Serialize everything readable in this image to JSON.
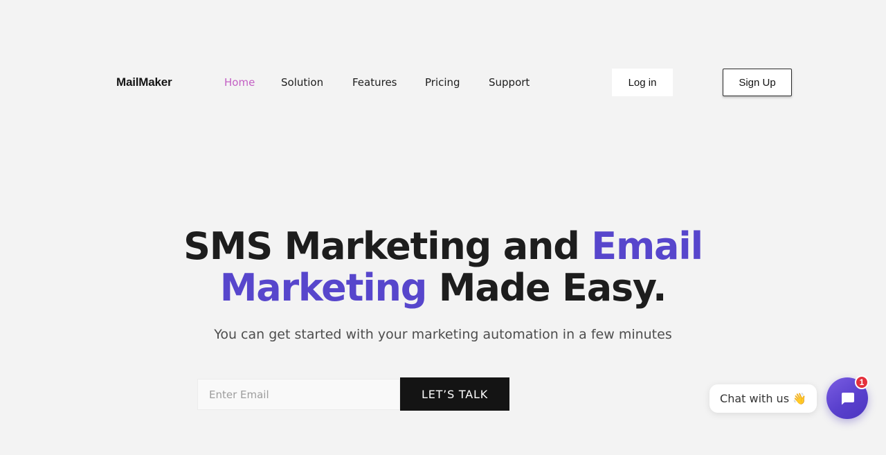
{
  "brand": {
    "name": "MailMaker"
  },
  "nav": {
    "items": [
      {
        "label": "Home",
        "active": true
      },
      {
        "label": "Solution",
        "active": false
      },
      {
        "label": "Features",
        "active": false
      },
      {
        "label": "Pricing",
        "active": false
      },
      {
        "label": "Support",
        "active": false
      }
    ]
  },
  "auth": {
    "login_label": "Log in",
    "signup_label": "Sign Up"
  },
  "hero": {
    "title_part1": "SMS Marketing and ",
    "title_accent1": "Email",
    "title_accent2": "Marketing",
    "title_part2": " Made Easy.",
    "subtitle": "You can get started with your marketing automation in a few minutes"
  },
  "signup_form": {
    "email_value": "",
    "email_placeholder": "Enter Email",
    "cta_label": "LET’S TALK"
  },
  "chat_widget": {
    "bubble_text": "Chat with us",
    "bubble_emoji": "👋",
    "launcher_icon": "chat-icon",
    "badge_count": "1"
  },
  "colors": {
    "background": "#f3f3f3",
    "nav_active": "#c35fc4",
    "accent": "#5746cc",
    "cta_background": "#141414",
    "chat_launcher": "#5940cd",
    "badge": "#e5303c"
  }
}
